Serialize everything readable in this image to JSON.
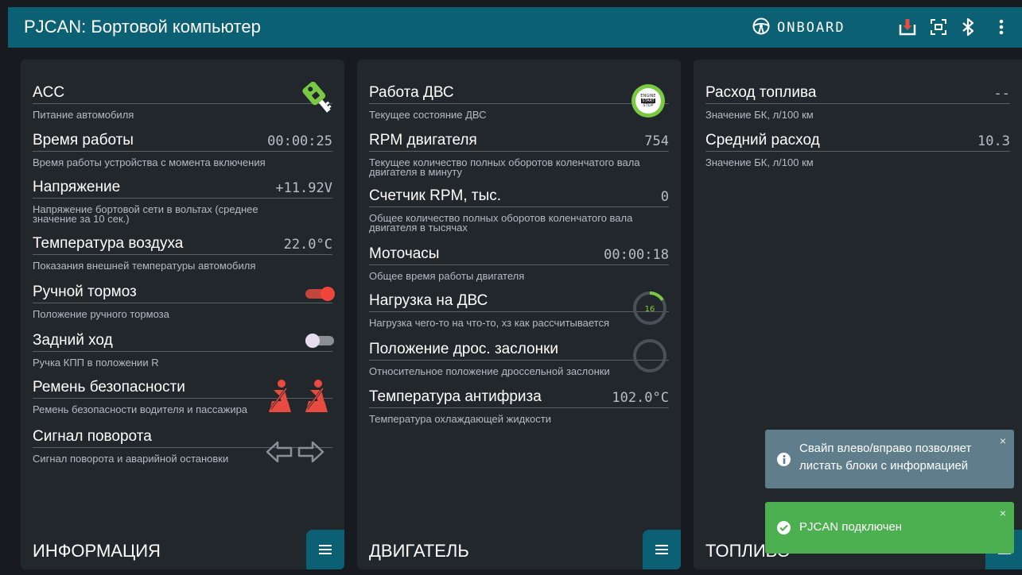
{
  "app": {
    "title": "PJCAN: Бортовой компьютер",
    "mode_label": "ONBOARD",
    "icons": [
      "steering-wheel-icon",
      "download-icon",
      "fullscreen-icon",
      "bluetooth-icon",
      "more-vert-icon"
    ]
  },
  "colors": {
    "topbar": "#0b6073",
    "panel": "#22272c",
    "background": "#171b1f",
    "accent_red": "#e84b3f",
    "accent_green": "#7ac943",
    "toast_info": "#607d8b",
    "toast_success": "#4caf50"
  },
  "panels": {
    "info": {
      "footer": "ИНФОРМАЦИЯ",
      "rows": {
        "acc": {
          "label": "ACC",
          "desc": "Питание автомобиля",
          "icon": "car-key-icon"
        },
        "uptime": {
          "label": "Время работы",
          "value": "00:00:25",
          "desc": "Время работы устройства с момента включения"
        },
        "voltage": {
          "label": "Напряжение",
          "value": "+11.92V",
          "desc": "Напряжение бортовой сети в вольтах (среднее значение за 10 сек.)"
        },
        "temperature": {
          "label": "Температура воздуха",
          "value": "22.0°C",
          "desc": "Показания внешней температуры автомобиля"
        },
        "handbrake": {
          "label": "Ручной тормоз",
          "desc": "Положение ручного тормоза",
          "state": "on"
        },
        "reverse": {
          "label": "Задний ход",
          "desc": "Ручка КПП в положении R",
          "state": "off"
        },
        "seatbelt": {
          "label": "Ремень безопасности",
          "desc": "Ремень безопасности водителя и пассажира",
          "icons": [
            "seatbelt-driver-icon",
            "seatbelt-passenger-icon"
          ]
        },
        "turn": {
          "label": "Сигнал поворота",
          "desc": "Сигнал поворота и аварийной остановки",
          "icons": [
            "turn-left-icon",
            "turn-right-icon"
          ]
        }
      }
    },
    "engine": {
      "footer": "ДВИГАТЕЛЬ",
      "rows": {
        "ice": {
          "label": "Работа ДВС",
          "desc": "Текущее состояние ДВС",
          "button_text": [
            "ENGINE",
            "START",
            "STOP"
          ]
        },
        "rpm": {
          "label": "RPM двигателя",
          "value": "754",
          "desc": "Текущее количество полных оборотов коленчатого вала двигателя в минуту"
        },
        "rpm_counter": {
          "label": "Счетчик RPM, тыс.",
          "value": "0",
          "desc": "Общее количество полных оборотов коленчатого вала двигателя в тысячах"
        },
        "motohours": {
          "label": "Моточасы",
          "value": "00:00:18",
          "desc": "Общее время работы двигателя"
        },
        "load": {
          "label": "Нагрузка на ДВС",
          "value": "16",
          "percent": 16,
          "desc": "Нагрузка чего-то на что-то, хз как рассчитывается"
        },
        "throttle": {
          "label": "Положение дрос. заслонки",
          "percent": 0,
          "desc": "Относительное положение дроссельной заслонки"
        },
        "coolant": {
          "label": "Температура антифриза",
          "value": "102.0°C",
          "desc": "Температура охлаждающей жидкости"
        }
      }
    },
    "fuel": {
      "footer": "ТОПЛИВО",
      "rows": {
        "consumption": {
          "label": "Расход топлива",
          "value": "--",
          "desc": "Значение БК, л/100 км"
        },
        "avg": {
          "label": "Средний расход",
          "value": "10.3",
          "desc": "Значение БК, л/100 км"
        }
      }
    }
  },
  "toasts": {
    "info": {
      "text": "Свайп влево/вправо позволяет листать блоки с информацией",
      "close": "×"
    },
    "success": {
      "text": "PJCAN подключен",
      "close": "×"
    }
  }
}
